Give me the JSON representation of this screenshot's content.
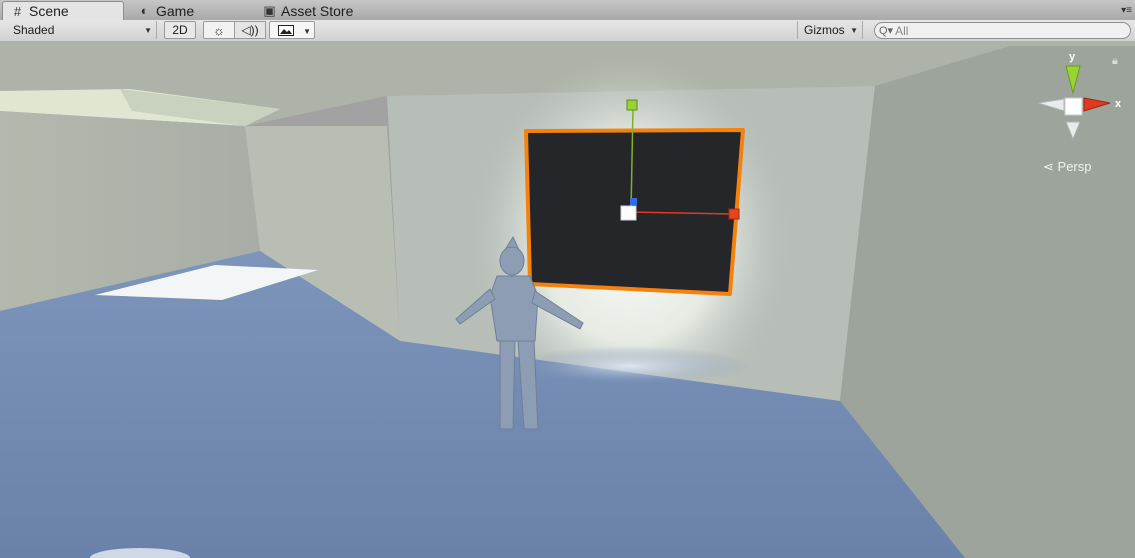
{
  "tabs": [
    {
      "label": "Scene",
      "icon": "grid-icon",
      "active": true
    },
    {
      "label": "Game",
      "icon": "pacman-icon",
      "active": false
    },
    {
      "label": "Asset Store",
      "icon": "bag-icon",
      "active": false
    }
  ],
  "toolbar": {
    "shading_mode": "Shaded",
    "toggle_2d": "2D",
    "lighting_icon": "sun-icon",
    "audio_icon": "speaker-icon",
    "effects_icon": "image-icon",
    "gizmos_label": "Gizmos",
    "search_placeholder": "All"
  },
  "scene_gizmo": {
    "axis_y": "y",
    "axis_x": "x",
    "projection": "Persp",
    "lock_icon": "lock-icon"
  },
  "colors": {
    "selection_outline": "#f5820d",
    "axis_x": "#e23a1d",
    "axis_y": "#9bd333",
    "axis_z": "#2d6fe0",
    "floor": "#7088b0"
  }
}
